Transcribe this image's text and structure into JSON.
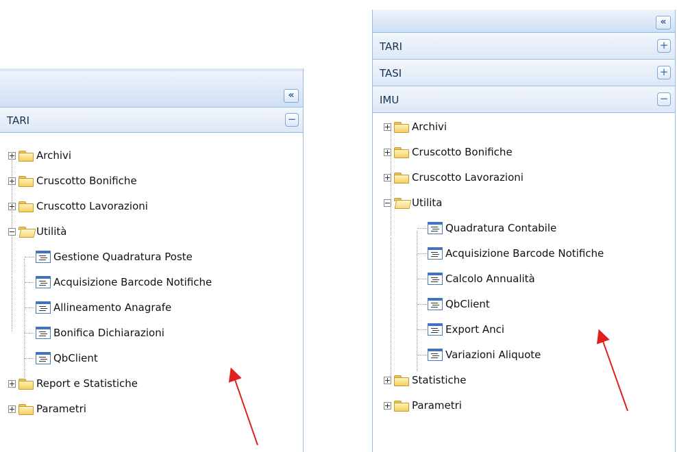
{
  "left_panel": {
    "collapse_glyph": "«",
    "section": {
      "title": "TARI",
      "toggle_glyph": "−"
    },
    "tree": [
      {
        "label": "Archivi",
        "expanded": false
      },
      {
        "label": "Cruscotto Bonifiche",
        "expanded": false
      },
      {
        "label": "Cruscotto Lavorazioni",
        "expanded": false
      },
      {
        "label": "Utilità",
        "expanded": true,
        "children": [
          "Gestione Quadratura Poste",
          "Acquisizione Barcode Notifiche",
          "Allineamento Anagrafe",
          "Bonifica Dichiarazioni",
          "QbClient"
        ]
      },
      {
        "label": "Report e Statistiche",
        "expanded": false
      },
      {
        "label": "Parametri",
        "expanded": false
      }
    ]
  },
  "right_panel": {
    "collapse_glyph": "«",
    "sections": [
      {
        "title": "TARI",
        "toggle_glyph": "+"
      },
      {
        "title": "TASI",
        "toggle_glyph": "+"
      },
      {
        "title": "IMU",
        "toggle_glyph": "−"
      }
    ],
    "tree": [
      {
        "label": "Archivi",
        "expanded": false
      },
      {
        "label": "Cruscotto Bonifiche",
        "expanded": false
      },
      {
        "label": "Cruscotto Lavorazioni",
        "expanded": false
      },
      {
        "label": "Utilita",
        "expanded": true,
        "children": [
          "Quadratura Contabile",
          "Acquisizione Barcode Notifiche",
          "Calcolo Annualità",
          "QbClient",
          "Export Anci",
          "Variazioni Aliquote"
        ]
      },
      {
        "label": "Statistiche",
        "expanded": false
      },
      {
        "label": "Parametri",
        "expanded": false
      }
    ]
  },
  "colors": {
    "border": "#99bbe8",
    "header": "#dde8f6",
    "annotation_arrow": "#e0201c"
  }
}
